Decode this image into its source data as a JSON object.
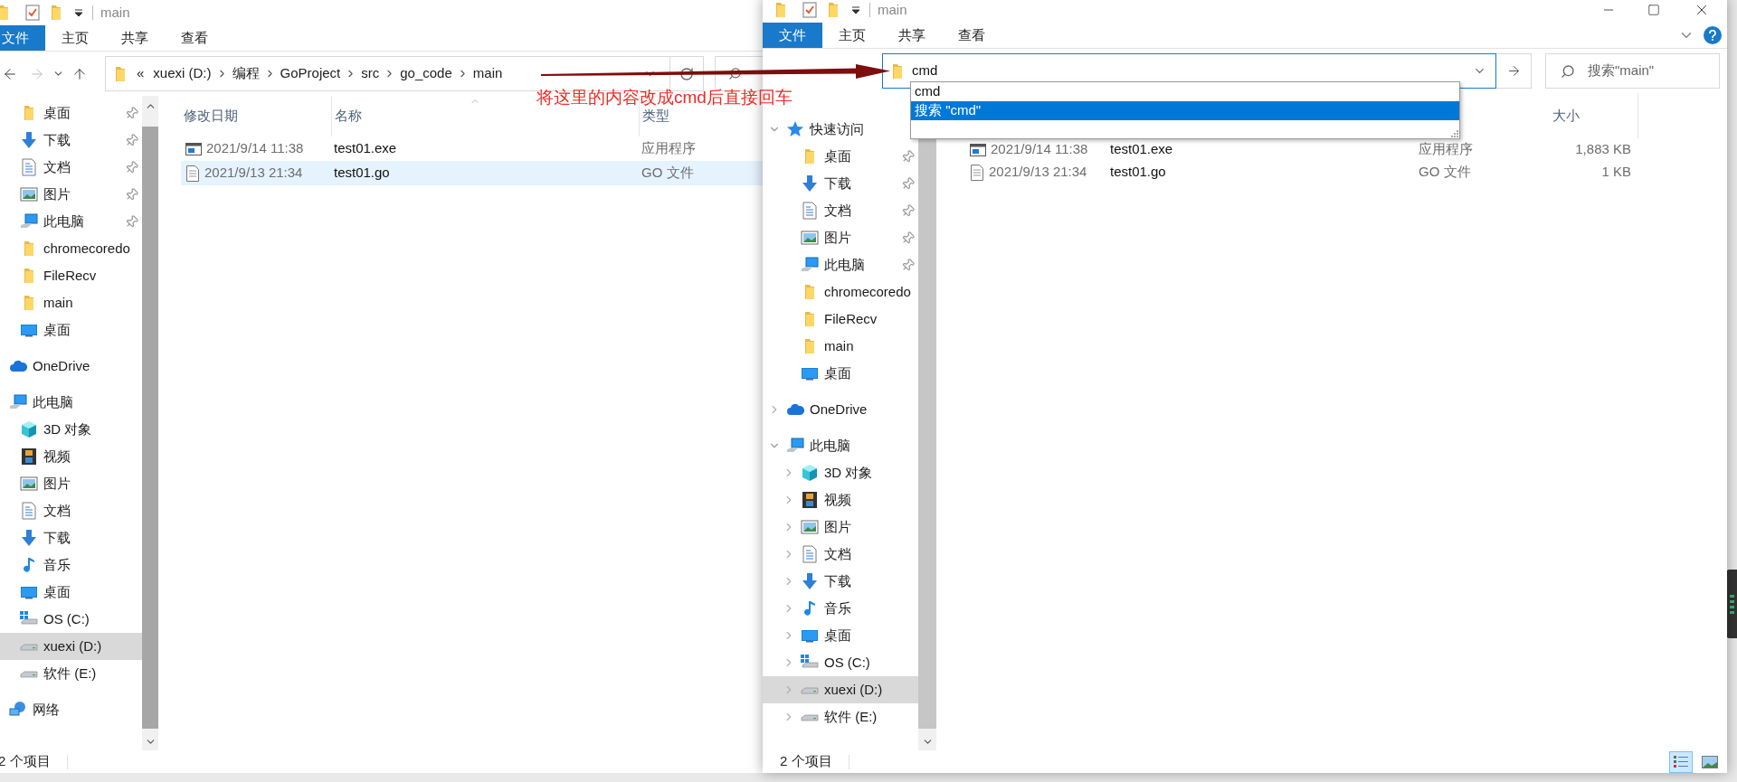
{
  "windows": [
    {
      "title": "main",
      "ribbon_tabs": [
        {
          "label": "文件",
          "selected": true
        },
        {
          "label": "主页",
          "selected": false
        },
        {
          "label": "共享",
          "selected": false
        },
        {
          "label": "查看",
          "selected": false
        }
      ],
      "address": {
        "kind": "breadcrumb",
        "prefix": "«",
        "crumbs": [
          "xuexi (D:)",
          "编程",
          "GoProject",
          "src",
          "go_code",
          "main"
        ]
      },
      "sidebar": [
        {
          "children": [
            {
              "label": "桌面",
              "kind": "folder",
              "pinned": true,
              "selected": false
            },
            {
              "label": "下载",
              "kind": "download",
              "pinned": true,
              "selected": false
            },
            {
              "label": "文档",
              "kind": "document",
              "pinned": true,
              "selected": false
            },
            {
              "label": "图片",
              "kind": "pictures",
              "pinned": true,
              "selected": false
            },
            {
              "label": "此电脑",
              "kind": "pc",
              "pinned": true,
              "selected": false
            },
            {
              "label": "chromecoredo",
              "kind": "folder",
              "pinned": false,
              "selected": false
            },
            {
              "label": "FileRecv",
              "kind": "folder",
              "pinned": false,
              "selected": false
            },
            {
              "label": "main",
              "kind": "folder",
              "pinned": false,
              "selected": false
            },
            {
              "label": "桌面",
              "kind": "desktop",
              "pinned": false,
              "selected": false
            }
          ]
        },
        {
          "label": "OneDrive",
          "kind": "onedrive",
          "selected": false
        },
        {
          "label": "此电脑",
          "kind": "pc",
          "selected": false,
          "children": [
            {
              "label": "3D 对象",
              "kind": "objects3d",
              "selected": false
            },
            {
              "label": "视频",
              "kind": "video",
              "selected": false
            },
            {
              "label": "图片",
              "kind": "pictures",
              "selected": false
            },
            {
              "label": "文档",
              "kind": "document",
              "selected": false
            },
            {
              "label": "下载",
              "kind": "download",
              "selected": false
            },
            {
              "label": "音乐",
              "kind": "music",
              "selected": false
            },
            {
              "label": "桌面",
              "kind": "desktop",
              "selected": false
            },
            {
              "label": "OS (C:)",
              "kind": "osdrive",
              "selected": false
            },
            {
              "label": "xuexi (D:)",
              "kind": "drive",
              "selected": true
            },
            {
              "label": "软件 (E:)",
              "kind": "drive",
              "selected": false
            }
          ]
        },
        {
          "label": "网络",
          "kind": "network",
          "selected": false
        }
      ],
      "columns": [
        {
          "label": "修改日期",
          "sorted": false
        },
        {
          "label": "名称",
          "sorted": true
        },
        {
          "label": "类型",
          "sorted": false
        }
      ],
      "rows": [
        {
          "kind": "exe",
          "cells": [
            "2021/9/14 11:38",
            "test01.exe",
            "应用程序"
          ],
          "selected": false
        },
        {
          "kind": "text",
          "cells": [
            "2021/9/13 21:34",
            "test01.go",
            "GO 文件"
          ],
          "selected": true
        }
      ],
      "status": "2 个项目"
    },
    {
      "title": "main",
      "ribbon_tabs": [
        {
          "label": "文件",
          "selected": true
        },
        {
          "label": "主页",
          "selected": false
        },
        {
          "label": "共享",
          "selected": false
        },
        {
          "label": "查看",
          "selected": false
        }
      ],
      "address": {
        "kind": "input",
        "value": "cmd"
      },
      "suggestions": [
        {
          "label": "cmd",
          "selected": false
        },
        {
          "label": "搜索 \"cmd\"",
          "selected": true
        }
      ],
      "search": {
        "placeholder": "搜索\"main\""
      },
      "sidebar": [
        {
          "label": "快速访问",
          "kind": "quickaccess",
          "selected": false,
          "expanded": true,
          "children": [
            {
              "label": "桌面",
              "kind": "folder",
              "pinned": true,
              "selected": false
            },
            {
              "label": "下载",
              "kind": "download",
              "pinned": true,
              "selected": false
            },
            {
              "label": "文档",
              "kind": "document",
              "pinned": true,
              "selected": false
            },
            {
              "label": "图片",
              "kind": "pictures",
              "pinned": true,
              "selected": false
            },
            {
              "label": "此电脑",
              "kind": "pc",
              "pinned": true,
              "selected": false
            },
            {
              "label": "chromecoredo",
              "kind": "folder",
              "pinned": false,
              "selected": false
            },
            {
              "label": "FileRecv",
              "kind": "folder",
              "pinned": false,
              "selected": false
            },
            {
              "label": "main",
              "kind": "folder",
              "pinned": false,
              "selected": false
            },
            {
              "label": "桌面",
              "kind": "desktop",
              "pinned": false,
              "selected": false
            }
          ]
        },
        {
          "label": "OneDrive",
          "kind": "onedrive",
          "selected": false,
          "expanded": false
        },
        {
          "label": "此电脑",
          "kind": "pc",
          "selected": false,
          "expanded": true,
          "children": [
            {
              "label": "3D 对象",
              "kind": "objects3d",
              "selected": false,
              "expanded": false
            },
            {
              "label": "视频",
              "kind": "video",
              "selected": false,
              "expanded": false
            },
            {
              "label": "图片",
              "kind": "pictures",
              "selected": false,
              "expanded": false
            },
            {
              "label": "文档",
              "kind": "document",
              "selected": false,
              "expanded": false
            },
            {
              "label": "下载",
              "kind": "download",
              "selected": false,
              "expanded": false
            },
            {
              "label": "音乐",
              "kind": "music",
              "selected": false,
              "expanded": false
            },
            {
              "label": "桌面",
              "kind": "desktop",
              "selected": false,
              "expanded": false
            },
            {
              "label": "OS (C:)",
              "kind": "osdrive",
              "selected": false,
              "expanded": false
            },
            {
              "label": "xuexi (D:)",
              "kind": "drive",
              "selected": true,
              "expanded": false
            },
            {
              "label": "软件 (E:)",
              "kind": "drive",
              "selected": false,
              "expanded": false
            }
          ]
        }
      ],
      "columns": [
        {
          "label": "大小",
          "sorted": false
        }
      ],
      "rows": [
        {
          "kind": "exe",
          "cells": [
            "2021/9/14 11:38",
            "test01.exe",
            "应用程序",
            "1,883 KB"
          ],
          "selected": false
        },
        {
          "kind": "text",
          "cells": [
            "2021/9/13 21:34",
            "test01.go",
            "GO 文件",
            "1 KB"
          ],
          "selected": false
        }
      ],
      "status": "2 个项目",
      "view_modes": [
        {
          "kind": "details",
          "selected": true
        },
        {
          "kind": "tiles",
          "selected": false
        }
      ]
    }
  ],
  "annotation": {
    "text": "将这里的内容改成cmd后直接回车"
  }
}
